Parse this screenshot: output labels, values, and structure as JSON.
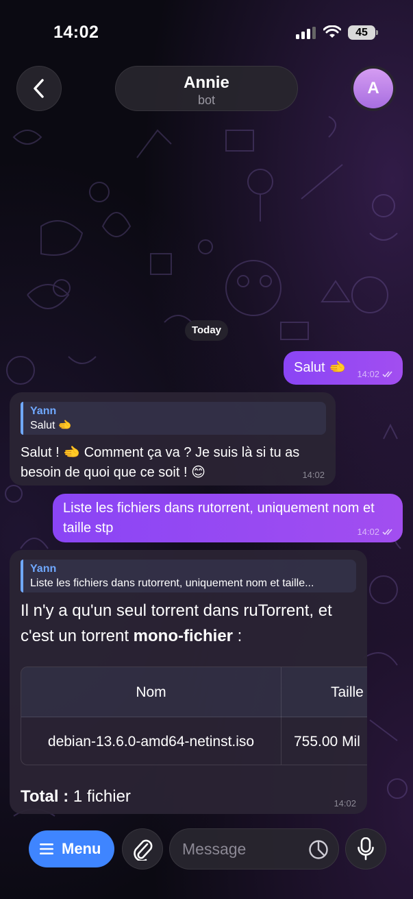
{
  "status_bar": {
    "time": "14:02",
    "battery": "45"
  },
  "header": {
    "name": "Annie",
    "subtitle": "bot",
    "avatar_letter": "A"
  },
  "date_chip": "Today",
  "messages": [
    {
      "dir": "out",
      "text": "Salut 🫲",
      "time": "14:02",
      "status": "read"
    },
    {
      "dir": "in",
      "reply": {
        "name": "Yann",
        "text": "Salut 🫲"
      },
      "text": "Salut ! 🫲 Comment ça va ? Je suis là si tu as besoin de quoi que ce soit ! 😊",
      "time": "14:02"
    },
    {
      "dir": "out",
      "text": "Liste les fichiers dans rutorrent, uniquement nom et taille stp",
      "time": "14:02",
      "status": "read"
    },
    {
      "dir": "in",
      "reply": {
        "name": "Yann",
        "text": "Liste les fichiers dans rutorrent, uniquement nom et taille..."
      },
      "text_a": "Il n'y a qu'un seul torrent dans ruTorrent, et c'est un torrent ",
      "text_bold": "mono-fichier",
      "text_b": " :",
      "table": {
        "headers": [
          "Nom",
          "Taille"
        ],
        "rows": [
          [
            "debian-13.6.0-amd64-netinst.iso",
            "755.00 Mil"
          ]
        ]
      },
      "total_label": "Total :",
      "total_value": " 1 fichier",
      "time": "14:02"
    }
  ],
  "composer": {
    "menu_label": "Menu",
    "placeholder": "Message"
  },
  "icons": [
    "back-icon",
    "attach-icon",
    "sticker-icon",
    "mic-icon",
    "menu-icon",
    "read-check-icon"
  ]
}
